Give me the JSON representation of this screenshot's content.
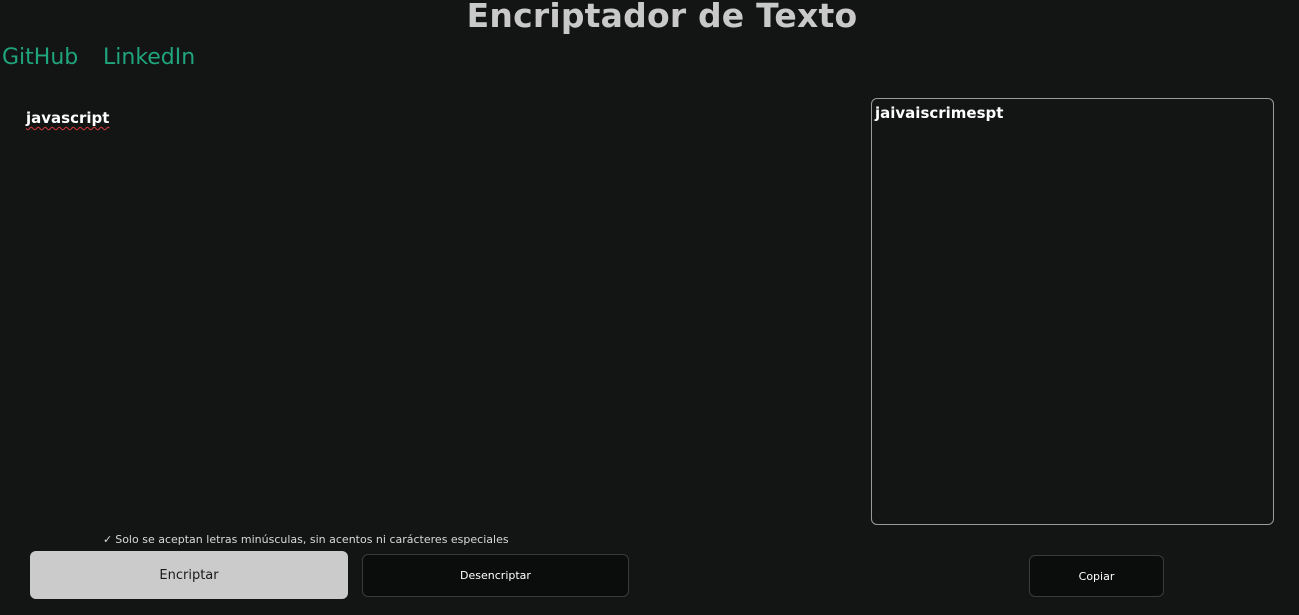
{
  "header": {
    "title": "Encriptador de Texto"
  },
  "nav": {
    "github": "GitHub",
    "linkedin": "LinkedIn"
  },
  "input": {
    "value": "javascript",
    "placeholder": ""
  },
  "output": {
    "value": "jaivaiscrimespt"
  },
  "hint": {
    "icon": "check-icon",
    "text": "Solo se aceptan letras minúsculas, sin acentos ni carácteres especiales"
  },
  "buttons": {
    "encrypt": "Encriptar",
    "decrypt": "Desencriptar",
    "copy": "Copiar"
  },
  "colors": {
    "background": "#131515",
    "title": "#c9c9c9",
    "link": "#1fa47c",
    "primary_button": "#cbcbcb",
    "secondary_button": "#0b0c0c",
    "output_border": "#9a9a9a"
  }
}
